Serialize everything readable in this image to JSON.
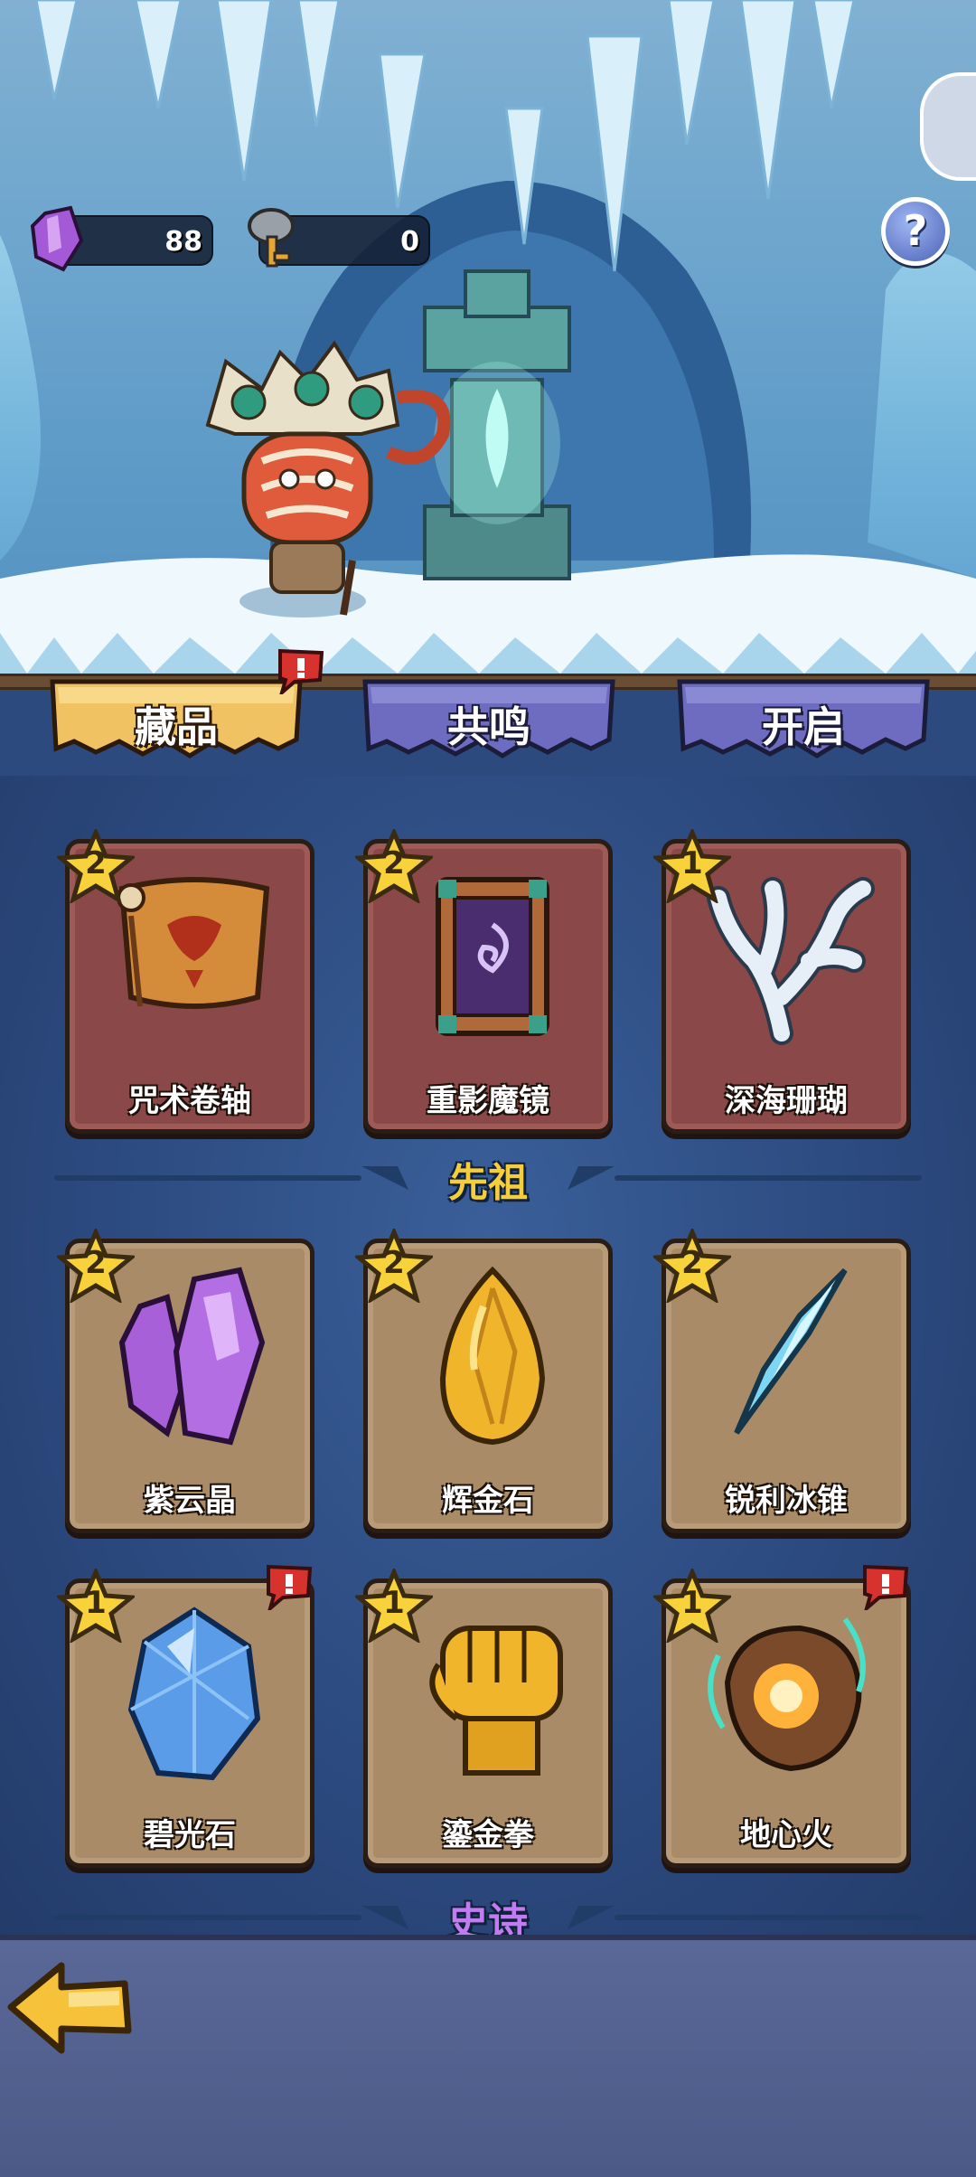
{
  "currencies": {
    "crystal": {
      "icon": "purple-crystal-icon",
      "value": "88"
    },
    "key": {
      "icon": "stone-key-icon",
      "value": "0"
    }
  },
  "help": {
    "icon": "question-mark-icon",
    "label": "?"
  },
  "tabs": [
    {
      "label": "藏品",
      "active": true,
      "alert": true
    },
    {
      "label": "共鸣",
      "active": false,
      "alert": false
    },
    {
      "label": "开启",
      "active": false,
      "alert": false
    }
  ],
  "rows": [
    {
      "items": [
        {
          "name": "咒术卷轴",
          "stars": "2",
          "icon": "scroll-icon",
          "alert": false
        },
        {
          "name": "重影魔镜",
          "stars": "2",
          "icon": "mirror-icon",
          "alert": false
        },
        {
          "name": "深海珊瑚",
          "stars": "1",
          "icon": "coral-icon",
          "alert": false
        }
      ]
    },
    {
      "items": [
        {
          "name": "紫云晶",
          "stars": "2",
          "icon": "purple-crystal-icon",
          "alert": false
        },
        {
          "name": "辉金石",
          "stars": "2",
          "icon": "gold-stone-icon",
          "alert": false
        },
        {
          "name": "锐利冰锥",
          "stars": "2",
          "icon": "ice-shard-icon",
          "alert": false
        }
      ]
    },
    {
      "items": [
        {
          "name": "碧光石",
          "stars": "1",
          "icon": "blue-gem-icon",
          "alert": true
        },
        {
          "name": "鎏金拳",
          "stars": "1",
          "icon": "golden-fist-icon",
          "alert": false
        },
        {
          "name": "地心火",
          "stars": "1",
          "icon": "magma-rock-icon",
          "alert": true
        }
      ]
    }
  ],
  "sections": {
    "ancestor": "先祖",
    "epic": "史诗"
  },
  "back": {
    "icon": "back-arrow-icon"
  },
  "colors": {
    "ancestor_label": "#f5cf3b",
    "epic_label": "#c07cf0",
    "active_tab": "#f1c261",
    "inactive_tab": "#6e6cc0"
  }
}
